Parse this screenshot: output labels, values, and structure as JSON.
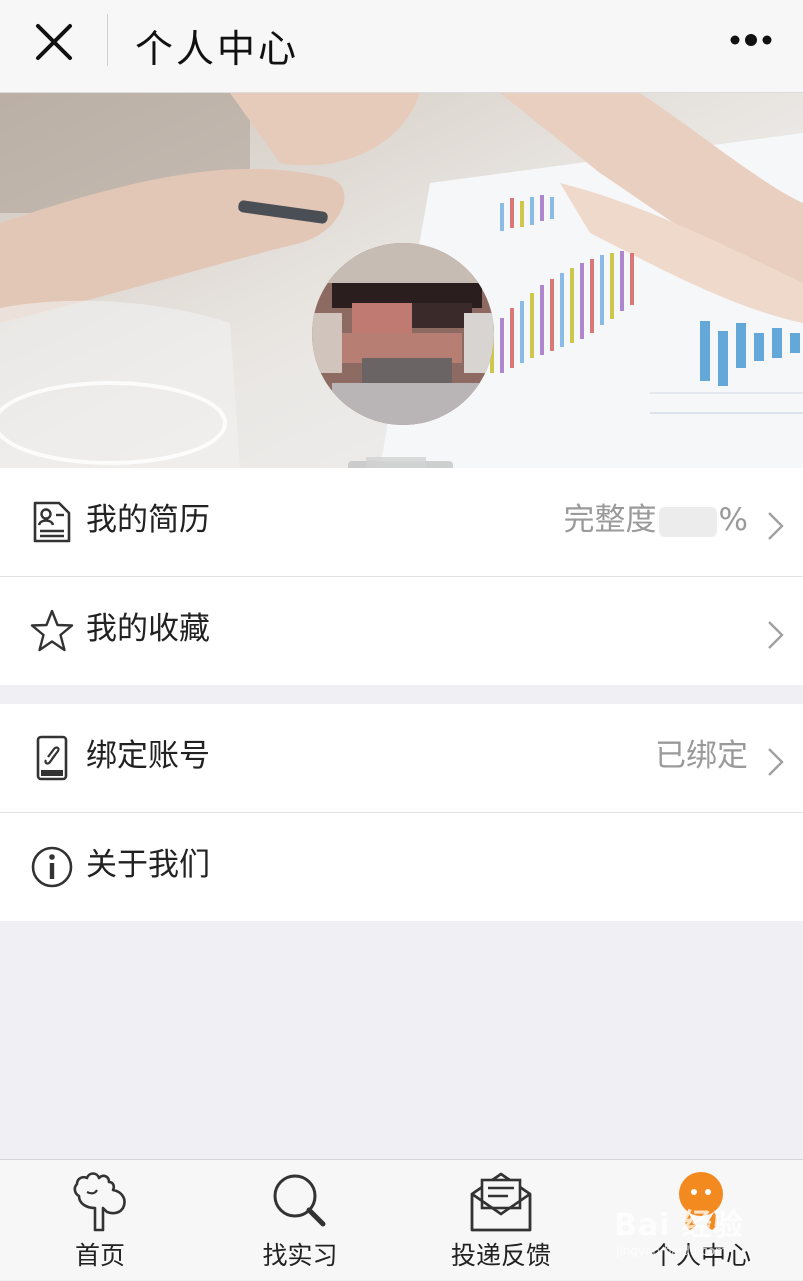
{
  "header": {
    "title": "个人中心",
    "close_icon": "close-icon",
    "more_icon": "more-dots-icon"
  },
  "menu": {
    "resume": {
      "label": "我的简历",
      "value_prefix": "完整度",
      "value_suffix": "%"
    },
    "favorites": {
      "label": "我的收藏"
    },
    "bind": {
      "label": "绑定账号",
      "value": "已绑定"
    },
    "about": {
      "label": "关于我们"
    }
  },
  "tabs": [
    {
      "label": "首页",
      "icon": "home-icon"
    },
    {
      "label": "找实习",
      "icon": "search-icon"
    },
    {
      "label": "投递反馈",
      "icon": "envelope-icon"
    },
    {
      "label": "个人中心",
      "icon": "profile-icon",
      "active": true
    }
  ],
  "colors": {
    "accent": "#f28a1f",
    "text": "#222222",
    "muted": "#9a9a9a",
    "background": "#efeff4"
  },
  "watermark": {
    "text": "Bai 经验",
    "sub": "jingyan.baidu.com"
  }
}
